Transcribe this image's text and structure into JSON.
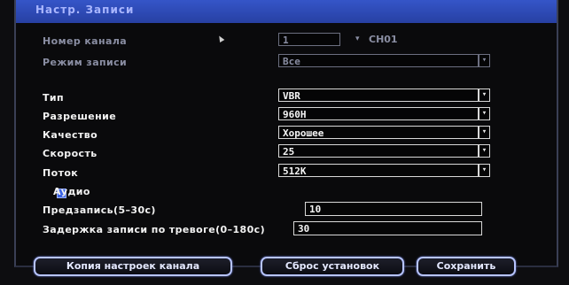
{
  "dialog": {
    "title": "Настр. Записи"
  },
  "channel": {
    "label": "Номер канала",
    "value": "1",
    "name": "CH01"
  },
  "record_mode": {
    "label": "Режим записи",
    "value": "Все"
  },
  "type": {
    "label": "Тип",
    "value": "VBR"
  },
  "resolution": {
    "label": "Разрешение",
    "value": "960H"
  },
  "quality": {
    "label": "Качество",
    "value": "Хорошее"
  },
  "speed": {
    "label": "Скорость",
    "value": "25"
  },
  "stream": {
    "label": "Поток",
    "value": "512K"
  },
  "audio": {
    "label": "Аудио",
    "checked": true
  },
  "prerecord": {
    "label": "Предзапись(5–30с)",
    "value": "10"
  },
  "alarm_delay": {
    "label": "Задержка записи по тревоге(0–180с)",
    "value": "30"
  },
  "buttons": {
    "copy": "Копия настроек канала",
    "reset": "Сброс установок",
    "save": "Сохранить"
  },
  "colors": {
    "title_bar": "#2f4bbd",
    "background": "#0a0a0c",
    "button_border": "#b7c4ff"
  }
}
